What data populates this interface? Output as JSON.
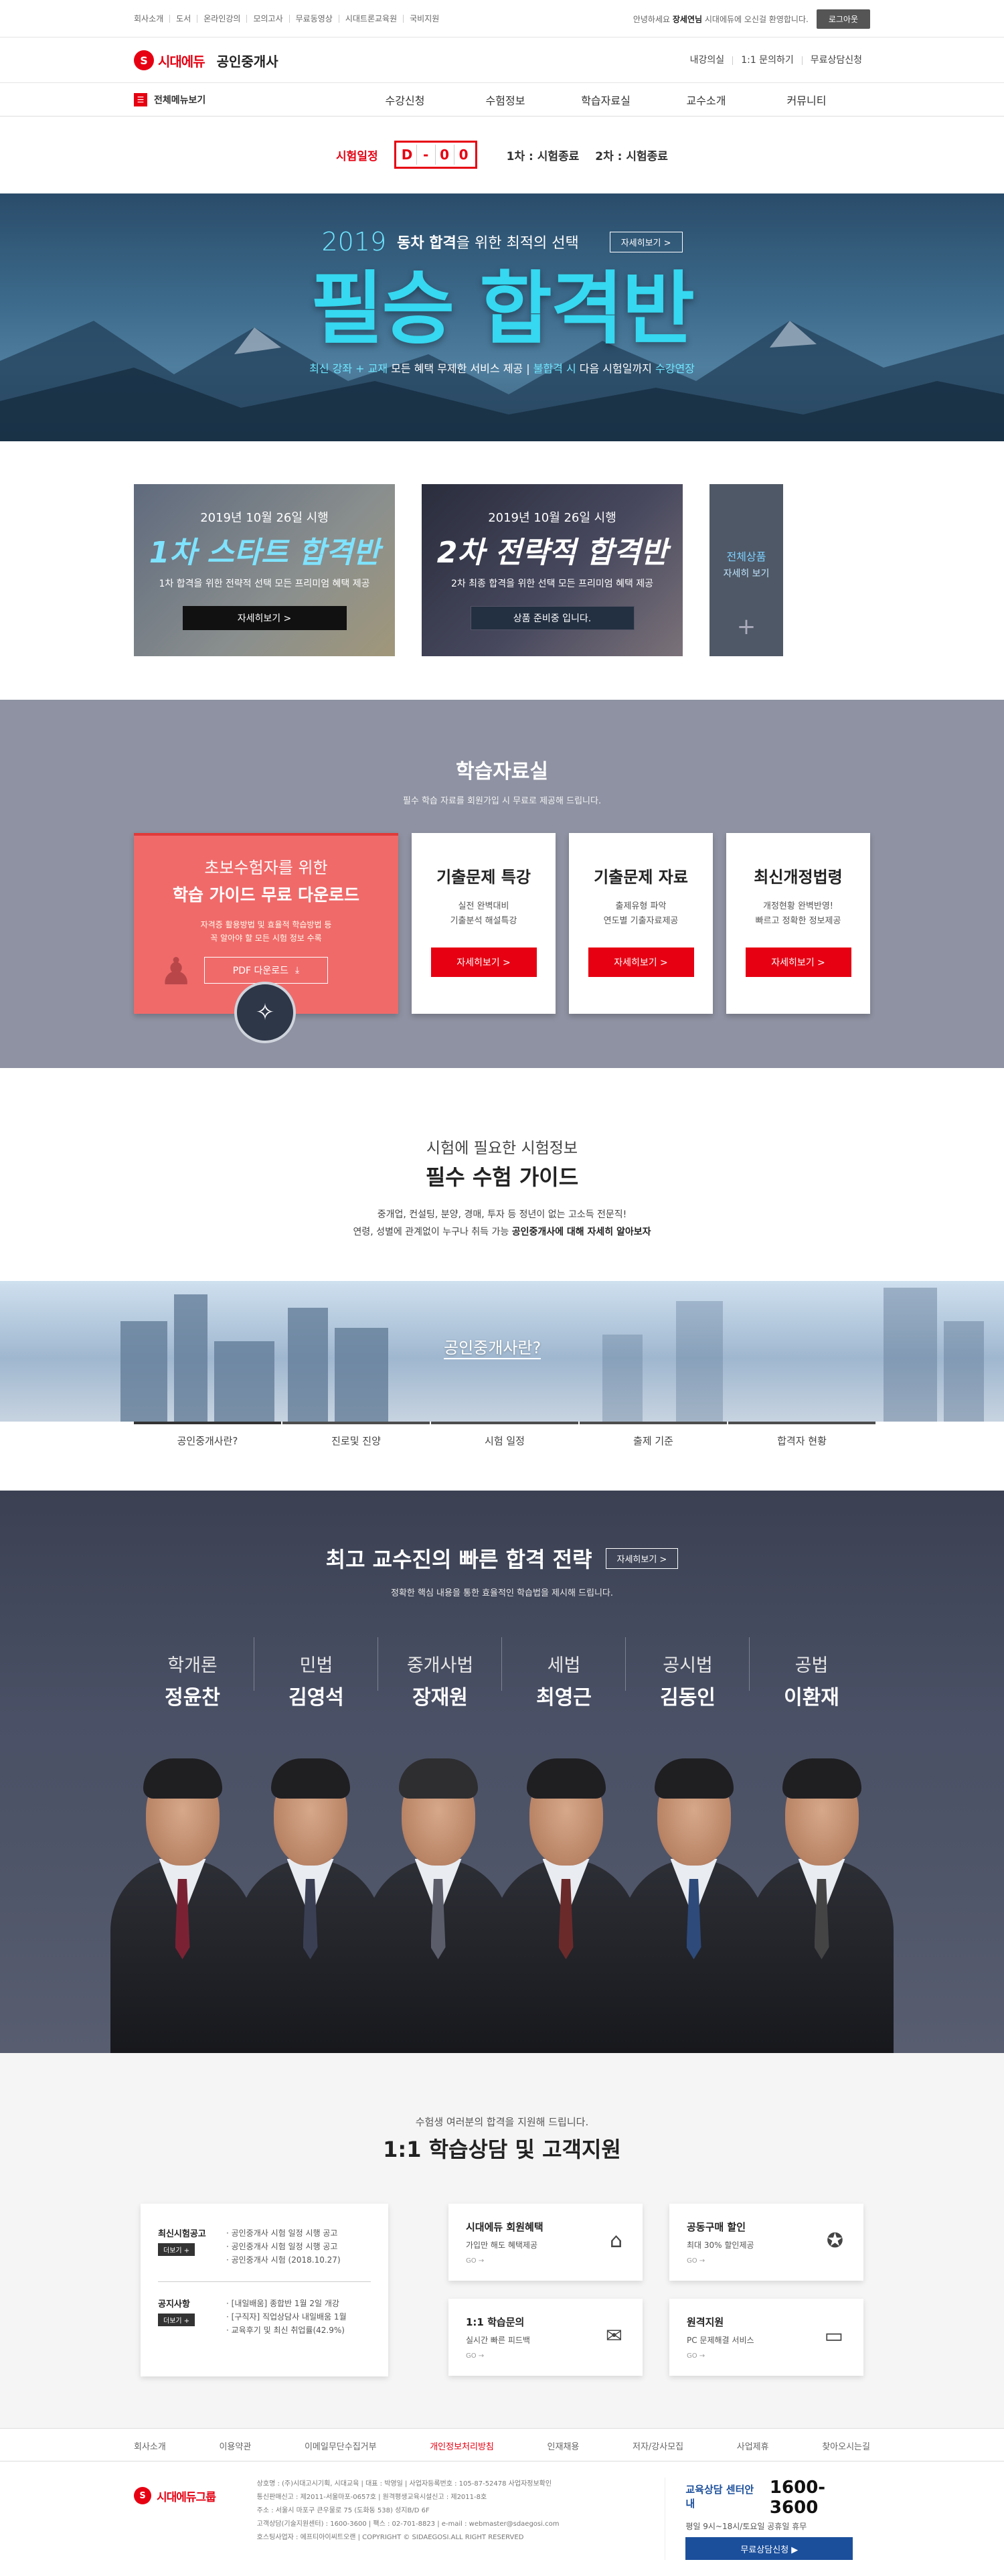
{
  "topbar": {
    "links": [
      "회사소개",
      "도서",
      "온라인강의",
      "모의고사",
      "무료동영상",
      "시대트론교육원",
      "국비지원"
    ],
    "greeting_prefix": "안녕하세요",
    "user_name": "장세연님",
    "greeting_suffix": "시대에듀에 오신걸 환영합니다.",
    "logout": "로그아웃"
  },
  "header": {
    "logo_text": "시대에듀",
    "site_name": "공인중개사",
    "links": [
      "내강의실",
      "1:1 문의하기",
      "무료상담신청"
    ]
  },
  "gnb": {
    "all_menu": "전체메뉴보기",
    "items": [
      "수강신청",
      "수험정보",
      "학습자료실",
      "교수소개",
      "커뮤니티"
    ]
  },
  "exam": {
    "label": "시험일정",
    "dday": [
      "D",
      "-",
      "0",
      "0"
    ],
    "first": "1차 : 시험종료",
    "second": "2차 : 시험종료"
  },
  "hero": {
    "year": "2019",
    "headline_bold": "동차 합격",
    "headline_rest": "을 위한 최적의 선택",
    "button": "자세히보기 >",
    "title": "필승 합격반",
    "sub_a": "최신 강좌 + 교재",
    "sub_b": " 모든 혜택 무제한 서비스 제공  |  ",
    "sub_c": "불합격 시",
    "sub_d": " 다음 시험일까지 ",
    "sub_e": "수강연장"
  },
  "products": [
    {
      "date": "2019년 10월 26일 시행",
      "title": "1차 스타트 합격반",
      "desc": "1차 합격을 위한 전략적 선택 모든 프리미엄 혜택 제공",
      "button": "자세히보기 >"
    },
    {
      "date": "2019년 10월 26일 시행",
      "title": "2차 전략적 합격반",
      "desc": "2차 최종 합격을 위한 선택 모든 프리미엄 혜택 제공",
      "button": "상품 준비중 입니다."
    }
  ],
  "all_products": {
    "line1": "전체상품",
    "line2": "자세히 보기",
    "plus": "+"
  },
  "study": {
    "title": "학습자료실",
    "subtitle": "필수 학습 자료를 회원가입 시 무료로 제공해 드립니다.",
    "guide": {
      "line1": "초보수험자를 위한",
      "line2": "학습 가이드 무료 다운로드",
      "desc1": "자격증 활용방법 및 효율적 학습방법 등",
      "desc2": "꼭 알아야 할 모든 시험 정보 수록",
      "pdf": "PDF 다운로드"
    },
    "cards": [
      {
        "title": "기출문제 특강",
        "desc1": "실전 완벽대비",
        "desc2": "기출분석 해설특강",
        "button": "자세히보기 >"
      },
      {
        "title": "기출문제 자료",
        "desc1": "출제유형 파악",
        "desc2": "연도별 기출자료제공",
        "button": "자세히보기 >"
      },
      {
        "title": "최신개정법령",
        "desc1": "개정현황 완벽반영!",
        "desc2": "빠르고 정확한 정보제공",
        "button": "자세히보기 >"
      }
    ]
  },
  "guide": {
    "pre": "시험에 필요한 시험정보",
    "title": "필수 수험 가이드",
    "desc1": "중개업, 컨설팅, 분양, 경매, 투자 등 정년이 없는 고소득 전문직!",
    "desc2_a": "연령, 성별에 관계없이 누구나 취득 가능 ",
    "desc2_b": "공인중개사에 대해 자세히 알아보자",
    "city_label": "공인중개사란?",
    "tabs": [
      "공인중개사란?",
      "진로및 진양",
      "시험 일정",
      "출제 기준",
      "합격자 현황"
    ]
  },
  "professors": {
    "title": "최고 교수진의 빠른 합격 전략",
    "button": "자세히보기 >",
    "subtitle": "정확한 핵심 내용을 통한 효율적인 학습법을 제시해 드립니다.",
    "list": [
      {
        "subject": "학개론",
        "name": "정윤찬"
      },
      {
        "subject": "민법",
        "name": "김영석"
      },
      {
        "subject": "중개사법",
        "name": "장재원"
      },
      {
        "subject": "세법",
        "name": "최영근"
      },
      {
        "subject": "공시법",
        "name": "김동인"
      },
      {
        "subject": "공법",
        "name": "이환재"
      }
    ]
  },
  "consult": {
    "pre": "수험생 여러분의 합격을 지원해 드립니다.",
    "title": "1:1 학습상담 및 고객지원",
    "notice": {
      "title": "최신시험공고",
      "more": "더보기 +",
      "items": [
        "공인중개사 시험 일정 시행 공고",
        "공인중개사 시험 일정 시행 공고",
        "공인중개사 시험 (2018.10.27)"
      ]
    },
    "faq": {
      "title": "공지사항",
      "more": "더보기 +",
      "items": [
        "[내일배움] 종합반 1월 2일 개강",
        "[구직자] 직업상담사 내일배움 1월",
        "교육후기 및 최신 취업률(42.9%)"
      ]
    },
    "services": [
      {
        "title": "시대에듀 회원혜택",
        "desc": "가입만 해도 혜택제공",
        "go": "GO →",
        "icon": "gift-icon"
      },
      {
        "title": "공동구매 할인",
        "desc": "최대 30% 할인제공",
        "go": "GO →",
        "icon": "medal-icon"
      },
      {
        "title": "1:1 학습문의",
        "desc": "실시간 빠른 피드백",
        "go": "GO →",
        "icon": "chat-icon"
      },
      {
        "title": "원격지원",
        "desc": "PC 문제해결 서비스",
        "go": "GO →",
        "icon": "monitor-icon"
      }
    ]
  },
  "footer_nav": [
    "회사소개",
    "이용약관",
    "이메일무단수집거부",
    "개인정보처리방침",
    "인재채용",
    "저자/강사모집",
    "사업제휴",
    "찾아오시는길"
  ],
  "footer": {
    "logo_text": "시대에듀그룹",
    "info": [
      "상호명 : (주)시대고시기획, 시대교육 | 대표 : 박영일 | 사업자등록번호 : 105-87-52478 사업자정보확인",
      "통신판매신고 : 제2011-서울마포-0657호 | 원격평생교육시설신고 : 제2011-8호",
      "주소 : 서울시 마포구 큰우물로 75 (도화동 538) 성지B/D 6F",
      "고객상담(기술지원센터) : 1600-3600 | 팩스 : 02-701-8823 | e-mail : webmaster@sdaegosi.com",
      "호스팅사업자 : 에프티아이씨트오랜 | COPYRIGHT © SIDAEGOSI.ALL RIGHT RESERVED"
    ],
    "cs_label": "교육상담 센터안내",
    "cs_phone": "1600-3600",
    "cs_hours": "평일 9시~18시/토요일 공휴일 휴무",
    "cs_button": "무료상담신청 ▶"
  },
  "colors": {
    "brand_red": "#e60012",
    "hero_cyan": "#35d8f0",
    "study_gray": "#8e92a2",
    "prof_dark": "#4a5065",
    "cs_blue": "#1b4f9c"
  }
}
